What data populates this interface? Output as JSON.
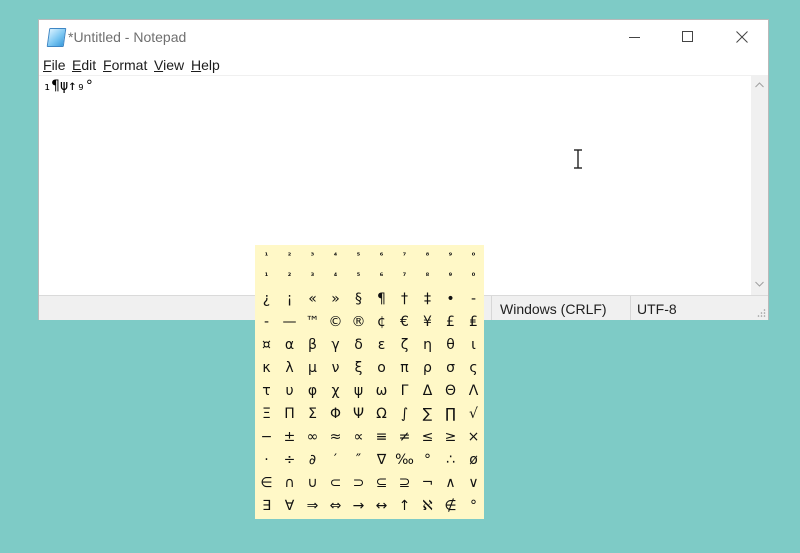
{
  "window": {
    "title": "*Untitled - Notepad",
    "minimize_icon": "minimize-icon",
    "maximize_icon": "maximize-icon",
    "close_icon": "close-icon"
  },
  "menu": [
    {
      "accel": "F",
      "rest": "ile"
    },
    {
      "accel": "E",
      "rest": "dit"
    },
    {
      "accel": "F",
      "rest": "ormat",
      "prefix": ""
    },
    {
      "accel": "V",
      "rest": "iew"
    },
    {
      "accel": "H",
      "rest": "elp"
    }
  ],
  "menu_labels": [
    "File",
    "Edit",
    "Format",
    "View",
    "Help"
  ],
  "editor": {
    "content": "₁¶ψ↑₉°"
  },
  "statusbar": {
    "line_ending": "Windows (CRLF)",
    "encoding": "UTF-8"
  },
  "palette": {
    "rows": [
      [
        "¹",
        "²",
        "³",
        "⁴",
        "⁵",
        "⁶",
        "⁷",
        "⁸",
        "⁹",
        "⁰"
      ],
      [
        "₁",
        "₂",
        "₃",
        "₄",
        "₅",
        "₆",
        "₇",
        "₈",
        "₉",
        "₀"
      ],
      [
        "¿",
        "¡",
        "«",
        "»",
        "§",
        "¶",
        "†",
        "‡",
        "•",
        "-"
      ],
      [
        "-",
        "—",
        "™",
        "©",
        "®",
        "¢",
        "€",
        "¥",
        "£",
        "₤"
      ],
      [
        "¤",
        "α",
        "β",
        "γ",
        "δ",
        "ε",
        "ζ",
        "η",
        "θ",
        "ι"
      ],
      [
        "κ",
        "λ",
        "μ",
        "ν",
        "ξ",
        "ο",
        "π",
        "ρ",
        "σ",
        "ς"
      ],
      [
        "τ",
        "υ",
        "φ",
        "χ",
        "ψ",
        "ω",
        "Γ",
        "Δ",
        "Θ",
        "Λ"
      ],
      [
        "Ξ",
        "Π",
        "Σ",
        "Φ",
        "Ψ",
        "Ω",
        "∫",
        "∑",
        "∏",
        "√"
      ],
      [
        "−",
        "±",
        "∞",
        "≈",
        "∝",
        "≡",
        "≠",
        "≤",
        "≥",
        "×"
      ],
      [
        "·",
        "÷",
        "∂",
        "′",
        "″",
        "∇",
        "‰",
        "°",
        "∴",
        "ø"
      ],
      [
        "∈",
        "∩",
        "∪",
        "⊂",
        "⊃",
        "⊆",
        "⊇",
        "¬",
        "∧",
        "∨"
      ],
      [
        "∃",
        "∀",
        "⇒",
        "⇔",
        "→",
        "↔",
        "↑",
        "ℵ",
        "∉",
        "°"
      ]
    ]
  },
  "colors": {
    "desktop": "#7ecbc6",
    "palette_bg": "#fff8c7"
  }
}
